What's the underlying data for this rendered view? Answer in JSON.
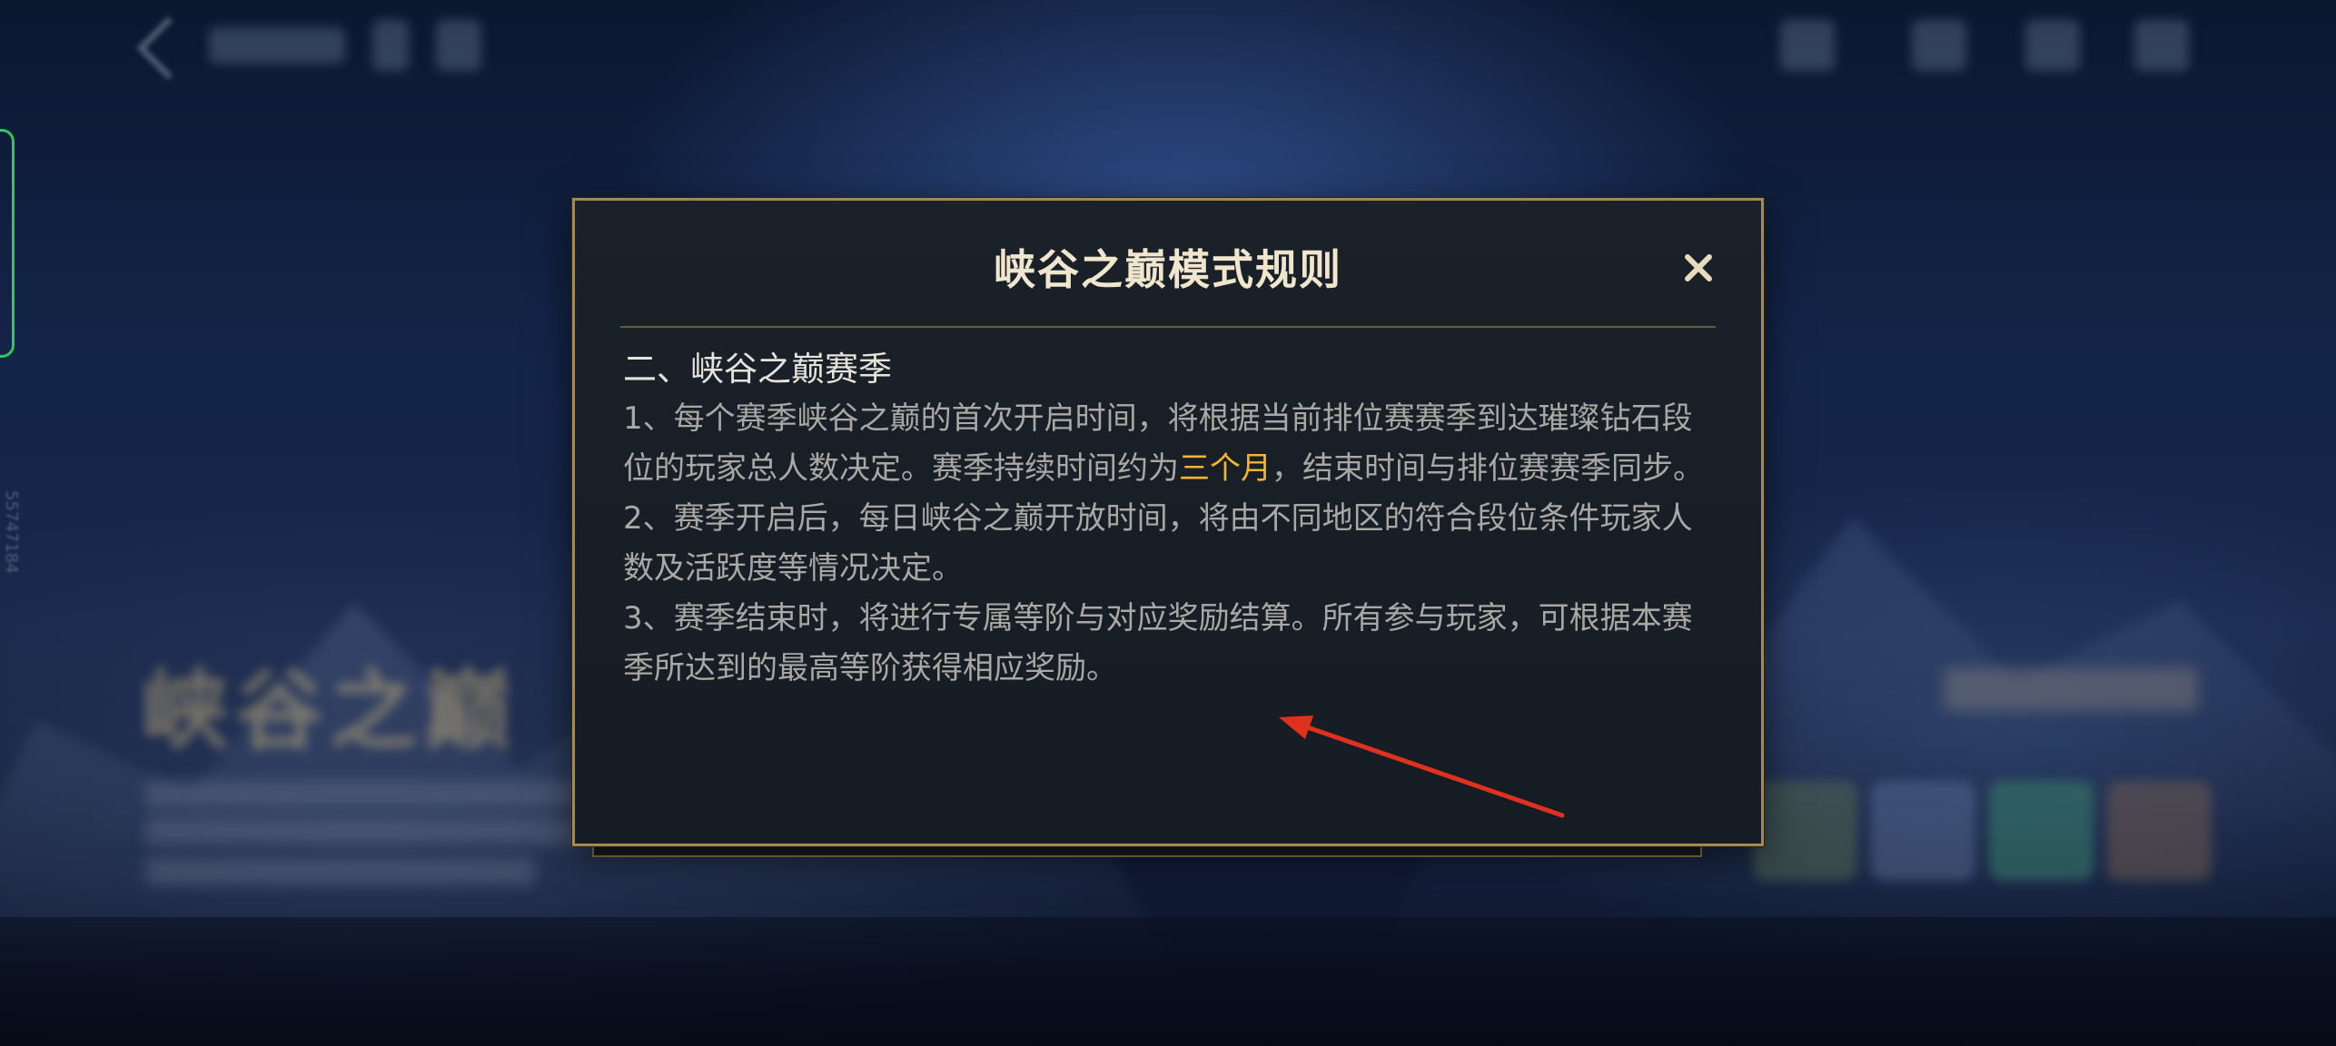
{
  "modal": {
    "title": "峡谷之巅模式规则",
    "close_label": "×",
    "section_heading": "二、峡谷之巅赛季",
    "rules": [
      {
        "before": "1、每个赛季峡谷之巅的首次开启时间，将根据当前排位赛赛季到达璀璨钻石段位的玩家总人数决定。赛季持续时间约为",
        "highlight": "三个月",
        "after": "，结束时间与排位赛赛季同步。"
      },
      {
        "text": "2、赛季开启后，每日峡谷之巅开放时间，将由不同地区的符合段位条件玩家人数及活跃度等情况决定。"
      },
      {
        "text": "3、赛季结束时，将进行专属等阶与对应奖励结算。所有参与玩家，可根据本赛季所达到的最高等阶获得相应奖励。"
      }
    ]
  },
  "background": {
    "mode_title": "峡谷之巅",
    "side_text": "55747184"
  },
  "colors": {
    "modal_border": "#a28a52",
    "highlight": "#f3b52c",
    "annotation_arrow": "#e0301e",
    "handle_outline": "#2fc85a"
  },
  "annotation": {
    "type": "arrow",
    "points_to": "rule-3-text"
  }
}
